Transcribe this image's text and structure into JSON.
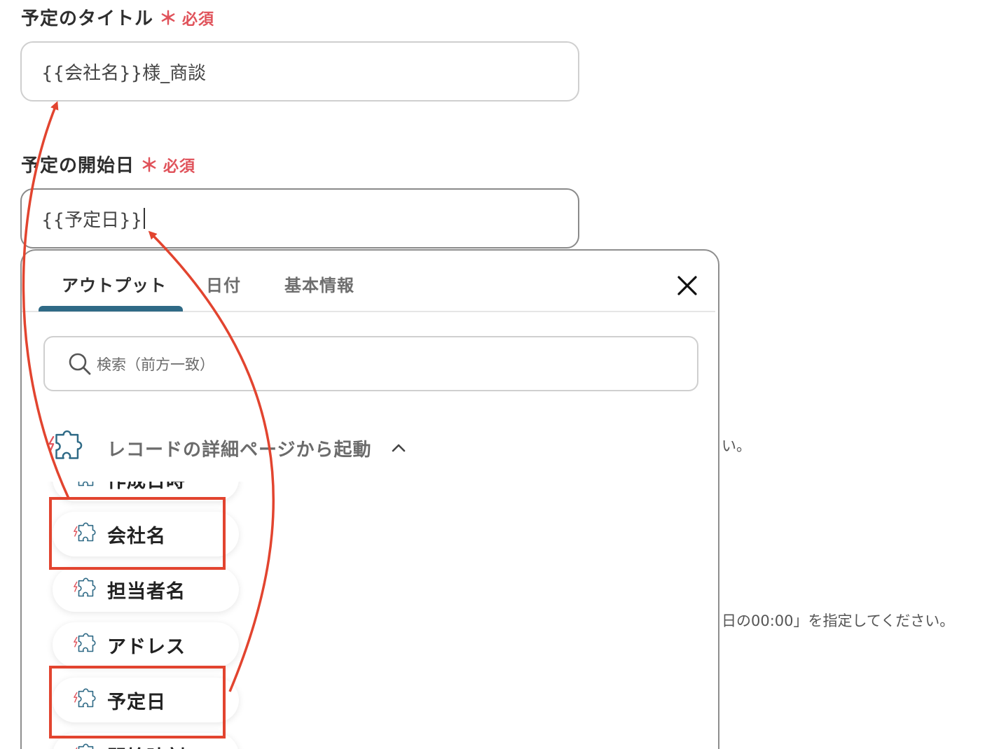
{
  "form": {
    "title_field": {
      "label": "予定のタイトル",
      "required_mark": "＊",
      "required_text": "必須",
      "value": "{{会社名}}様_商談"
    },
    "start_date_field": {
      "label": "予定の開始日",
      "required_mark": "＊",
      "required_text": "必須",
      "value": "{{予定日}}"
    },
    "hint_fragment_1": "い。",
    "hint_fragment_2": "日の00:00」を指定してください。"
  },
  "picker": {
    "tabs": [
      {
        "label": "アウトプット",
        "active": true
      },
      {
        "label": "日付",
        "active": false
      },
      {
        "label": "基本情報",
        "active": false
      }
    ],
    "search_placeholder": "検索（前方一致）",
    "group_label": "レコードの詳細ページから起動",
    "items": [
      {
        "label": "作成日時",
        "partial": true
      },
      {
        "label": "会社名",
        "highlighted": true
      },
      {
        "label": "担当者名"
      },
      {
        "label": "アドレス"
      },
      {
        "label": "予定日",
        "highlighted": true
      },
      {
        "label": "開始時刻",
        "partial": true
      }
    ]
  },
  "colors": {
    "required": "#e0525a",
    "tab_indicator": "#2f6a86",
    "annotation": "#e2442f",
    "icon": "#2f6a86"
  },
  "icons": {
    "item": "puzzle-bolt-icon",
    "close": "close-icon",
    "search": "search-icon",
    "group_toggle": "chevron-up-icon"
  }
}
